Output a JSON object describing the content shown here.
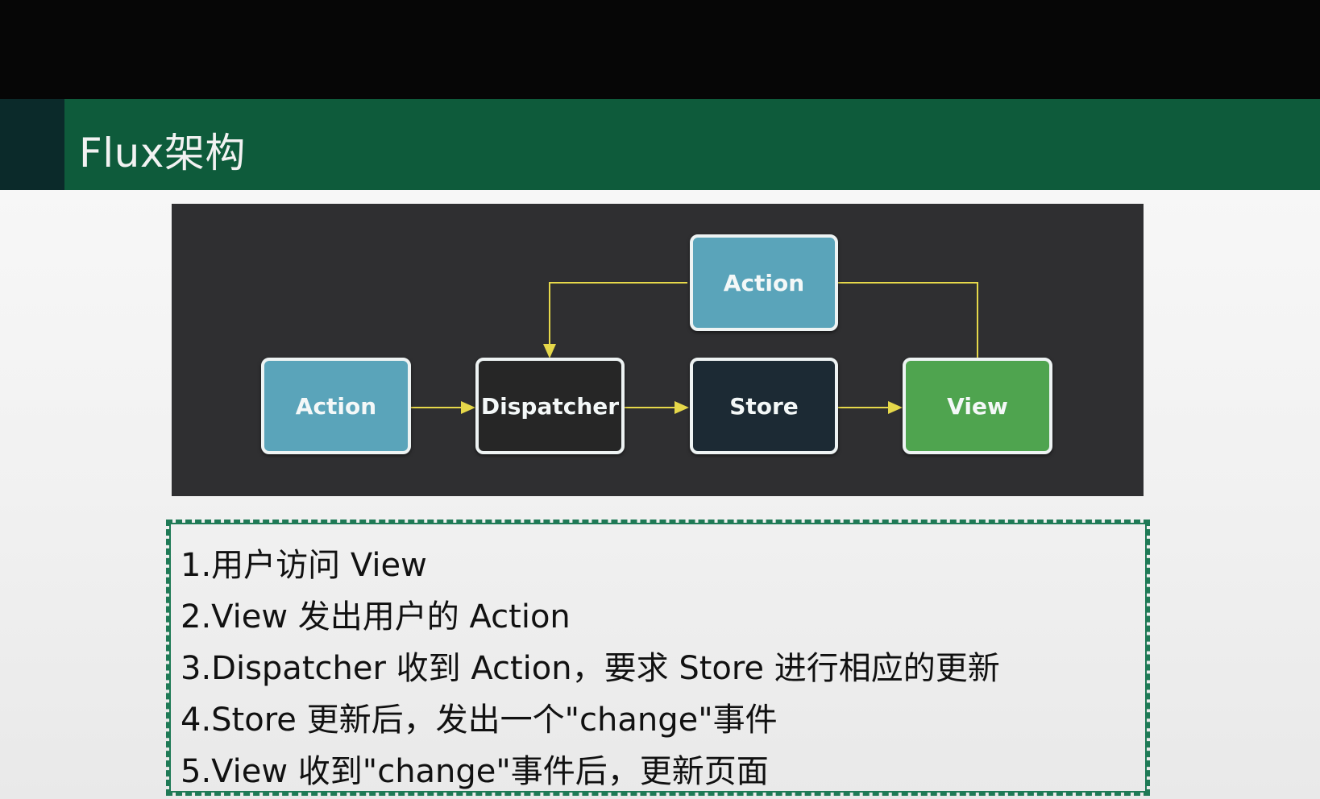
{
  "title": "Flux架构",
  "diagram": {
    "nodes": {
      "action_top": "Action",
      "action_left": "Action",
      "dispatcher": "Dispatcher",
      "store": "Store",
      "view": "View"
    },
    "colors": {
      "action": "#5aa4ba",
      "dispatcher": "#262626",
      "store": "#1c2a34",
      "view": "#4fa44f",
      "arrow": "#e6d84a"
    }
  },
  "steps": [
    "1.用户访问 View",
    "2.View 发出用户的 Action",
    "3.Dispatcher 收到 Action，要求 Store 进行相应的更新",
    "4.Store 更新后，发出一个\"change\"事件",
    "5.View 收到\"change\"事件后，更新页面"
  ]
}
